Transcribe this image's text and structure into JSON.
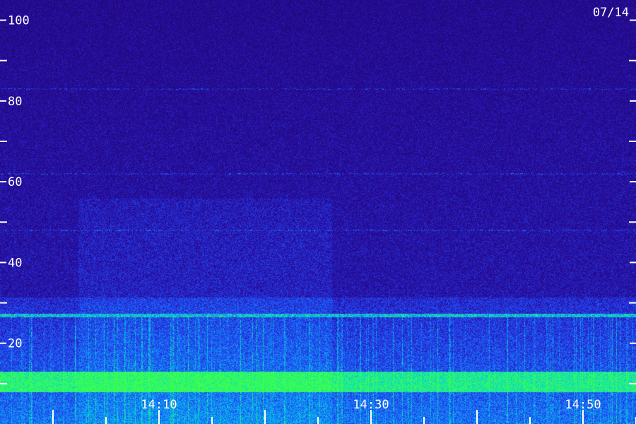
{
  "chart_data": {
    "type": "heatmap",
    "date_label": "07/14",
    "y_ticks": {
      "major": [
        100,
        80,
        60,
        40,
        20
      ],
      "major_labels": [
        "100",
        "80",
        "60",
        "40",
        "20"
      ],
      "minor": [
        90,
        70,
        50,
        30,
        10
      ],
      "ylim": [
        0,
        105
      ]
    },
    "x_ticks": {
      "labels": [
        "14:10",
        "14:30",
        "14:50"
      ],
      "label_minutes": [
        10,
        30,
        50
      ],
      "tick_minutes": [
        0,
        5,
        10,
        15,
        20,
        25,
        30,
        35,
        40,
        45,
        50,
        55,
        60
      ],
      "xlim_minutes": [
        -5,
        55
      ]
    },
    "features": {
      "strong_band_freq": 27,
      "bright_low_band_freq": [
        8,
        13
      ],
      "weak_lines_freq": [
        48,
        62,
        83
      ]
    },
    "colors": {
      "background": "#1a0a50",
      "noise_low": "#200a6a",
      "noise_mid": "#3a1ab8",
      "blue": "#2a3cff",
      "cyan": "#00d0ff",
      "green": "#30ff60",
      "text": "#ffffff"
    }
  }
}
